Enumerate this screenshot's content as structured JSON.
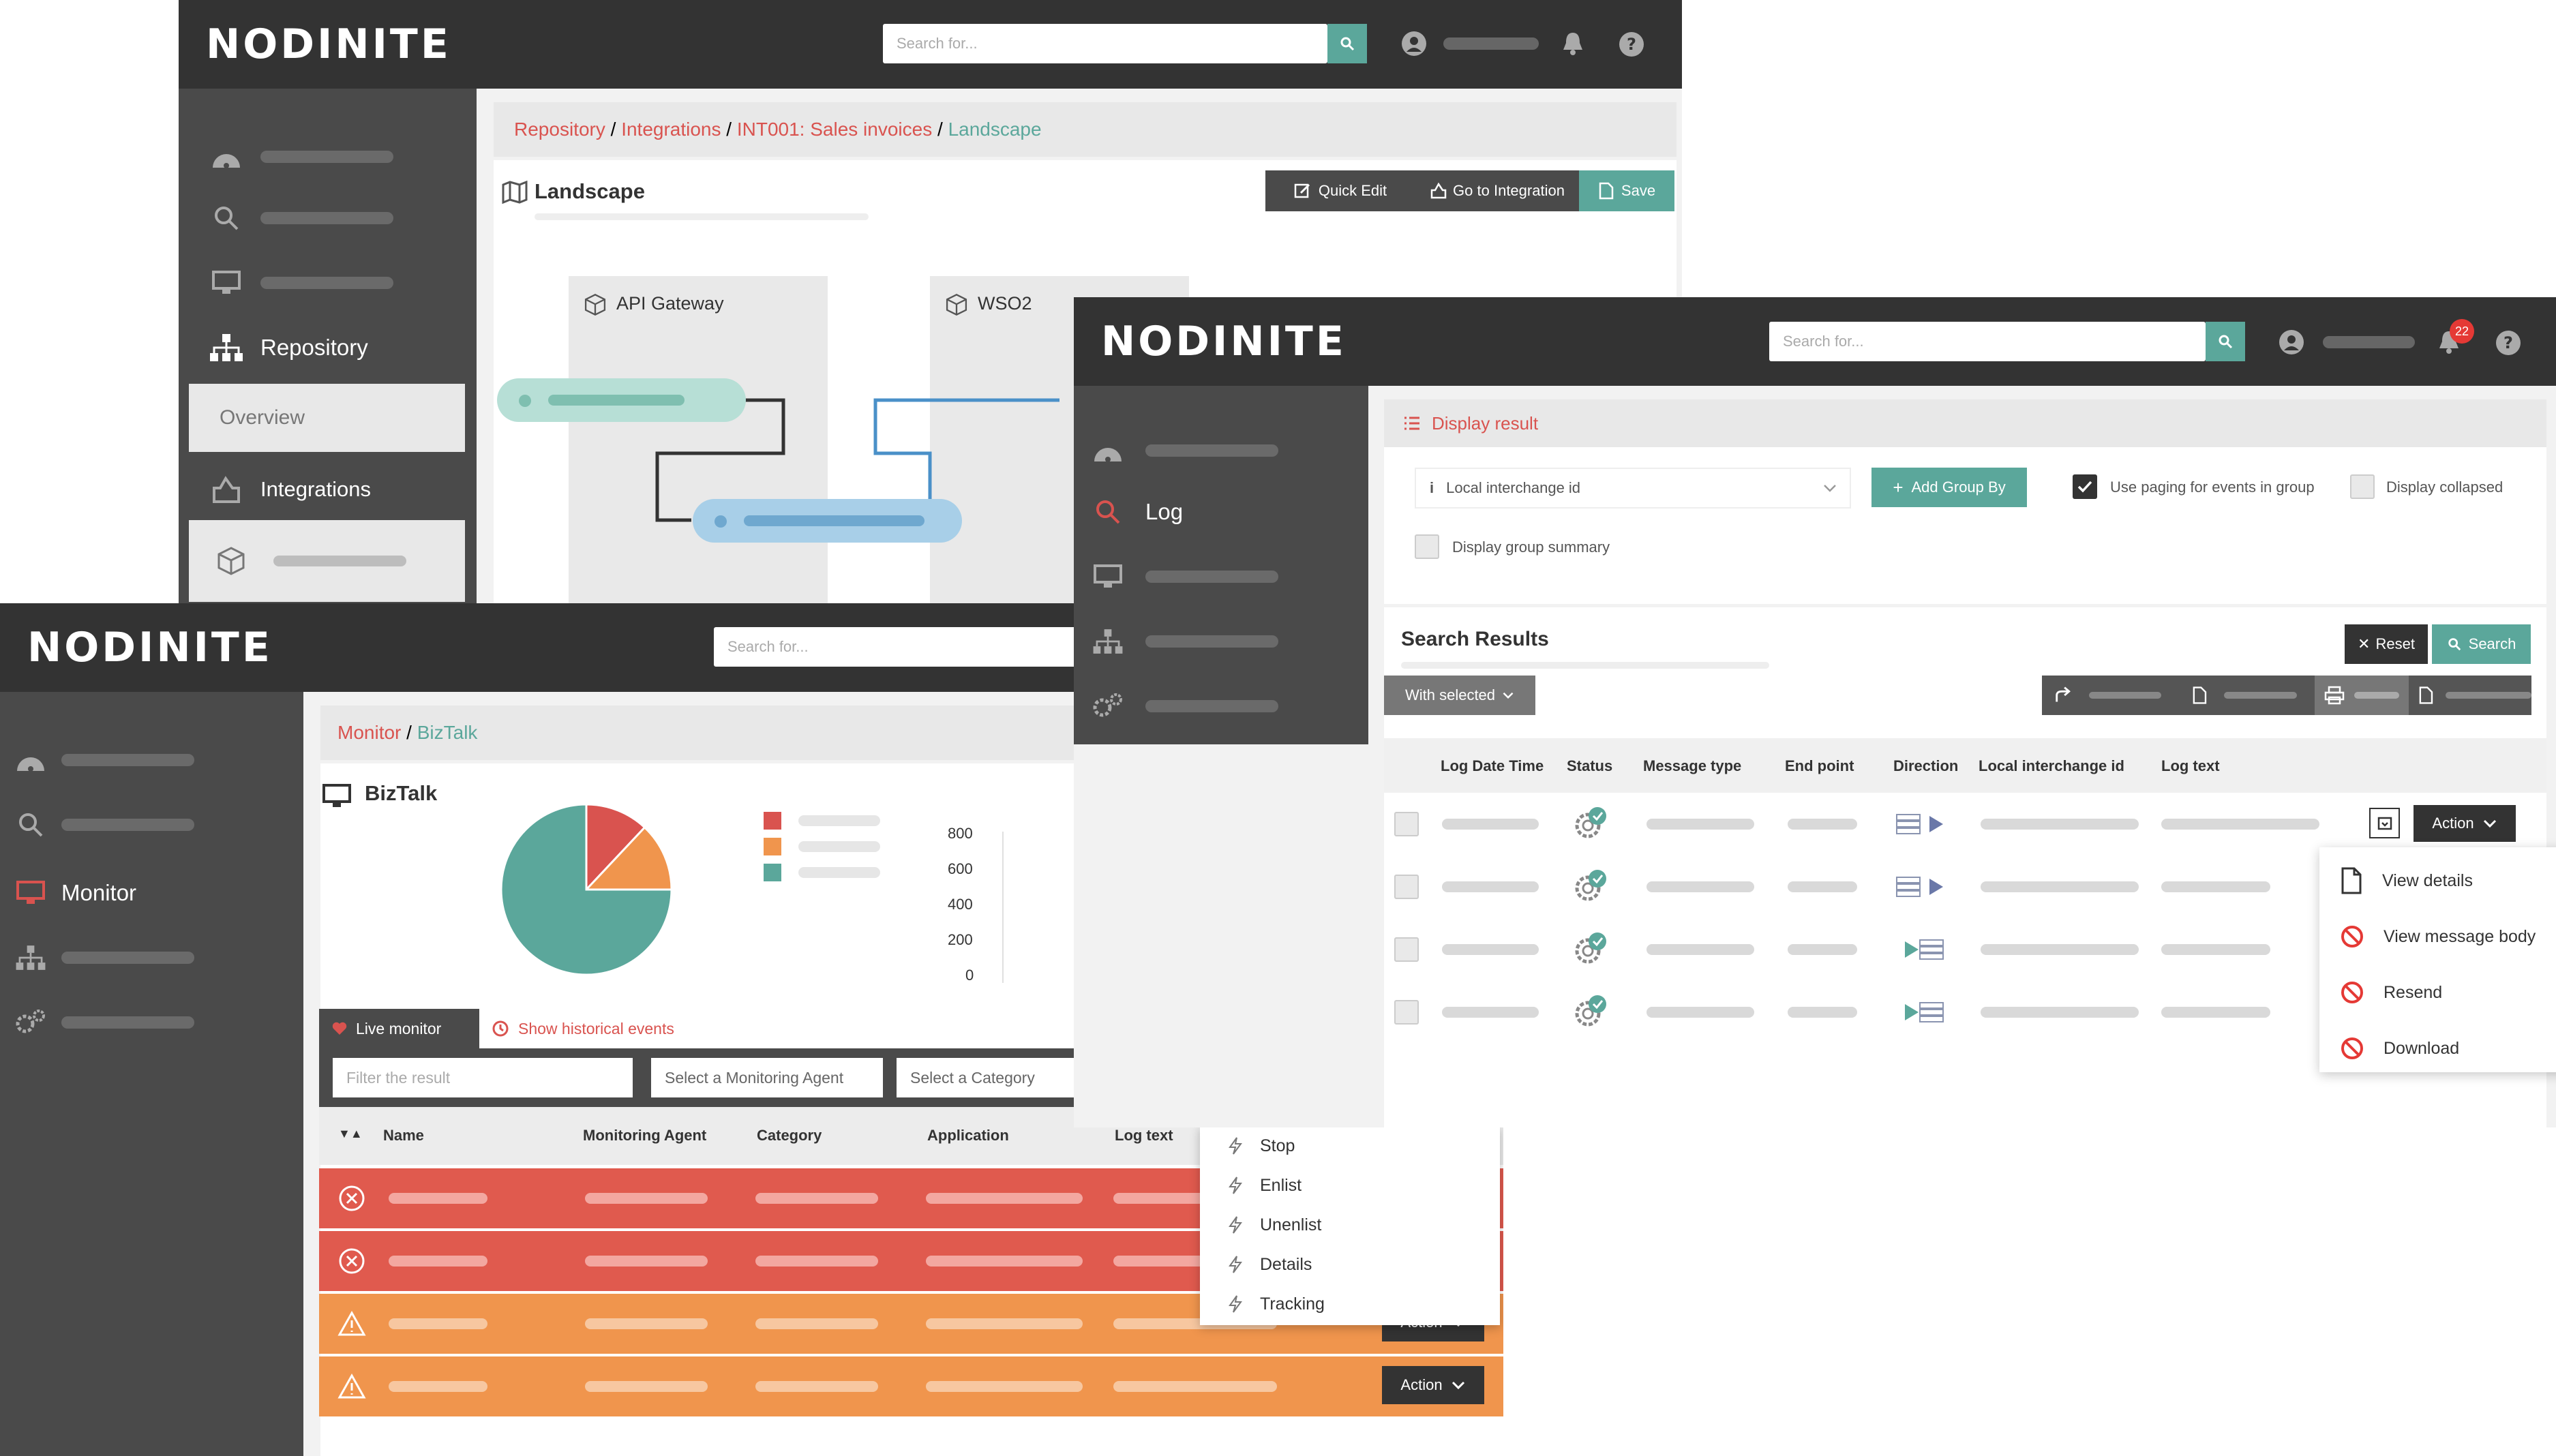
{
  "brand": {
    "logo": "NODINITE",
    "teal": "#5ba79b",
    "red": "#d9534f",
    "dark": "#333333",
    "orange": "#f0954d"
  },
  "landscape_window": {
    "search_placeholder": "Search for...",
    "sidebar": {
      "repository": "Repository",
      "overview": "Overview",
      "integrations": "Integrations"
    },
    "breadcrumb": {
      "a": "Repository",
      "b": "Integrations",
      "c": "INT001: Sales invoices",
      "d": "Landscape",
      "sep": " / "
    },
    "title": "Landscape",
    "buttons": {
      "quick_edit": "Quick Edit",
      "go_to_integration": "Go to Integration",
      "save": "Save"
    },
    "nodes": {
      "api_gateway": "API Gateway",
      "wso2": "WSO2"
    }
  },
  "monitor_window": {
    "search_placeholder": "Search for...",
    "sidebar": {
      "monitor": "Monitor"
    },
    "breadcrumb": {
      "a": "Monitor",
      "b": "BizTalk",
      "sep": " / "
    },
    "title": "BizTalk",
    "chart_data": {
      "type": "pie",
      "slices": [
        {
          "color": "#d9534f",
          "value": 12
        },
        {
          "color": "#f0954d",
          "value": 13
        },
        {
          "color": "#5ba79b",
          "value": 75
        }
      ],
      "bar_axis_ticks": [
        "800",
        "600",
        "400",
        "200",
        "0"
      ]
    },
    "tabs": {
      "live": "Live monitor",
      "historical": "Show historical events"
    },
    "filters": {
      "result": "Filter the result",
      "agent": "Select a Monitoring Agent",
      "category": "Select a Category"
    },
    "columns": {
      "name": "Name",
      "agent": "Monitoring Agent",
      "category": "Category",
      "application": "Application",
      "log_text": "Log text"
    },
    "rows": [
      {
        "status": "error"
      },
      {
        "status": "error"
      },
      {
        "status": "warning"
      },
      {
        "status": "warning"
      }
    ],
    "action_label": "Action",
    "context_menu": [
      "Stop",
      "Enlist",
      "Unenlist",
      "Details",
      "Tracking"
    ]
  },
  "log_window": {
    "search_placeholder": "Search for...",
    "notification_count": "22",
    "sidebar": {
      "log": "Log"
    },
    "display_result": "Display result",
    "group_field": "Local interchange id",
    "add_group_by": "Add Group By",
    "use_paging": "Use paging for events in group",
    "display_collapsed": "Display collapsed",
    "display_group_summary": "Display group summary",
    "search_results": "Search Results",
    "reset": "Reset",
    "search": "Search",
    "with_selected": "With selected",
    "columns": {
      "log_date_time": "Log Date Time",
      "status": "Status",
      "message_type": "Message type",
      "end_point": "End point",
      "direction": "Direction",
      "local_interchange_id": "Local interchange id",
      "log_text": "Log text"
    },
    "rows": [
      {
        "direction": "out"
      },
      {
        "direction": "out"
      },
      {
        "direction": "in"
      },
      {
        "direction": "in"
      }
    ],
    "action_label": "Action",
    "action_menu": [
      "View details",
      "View message body",
      "Resend",
      "Download"
    ]
  }
}
